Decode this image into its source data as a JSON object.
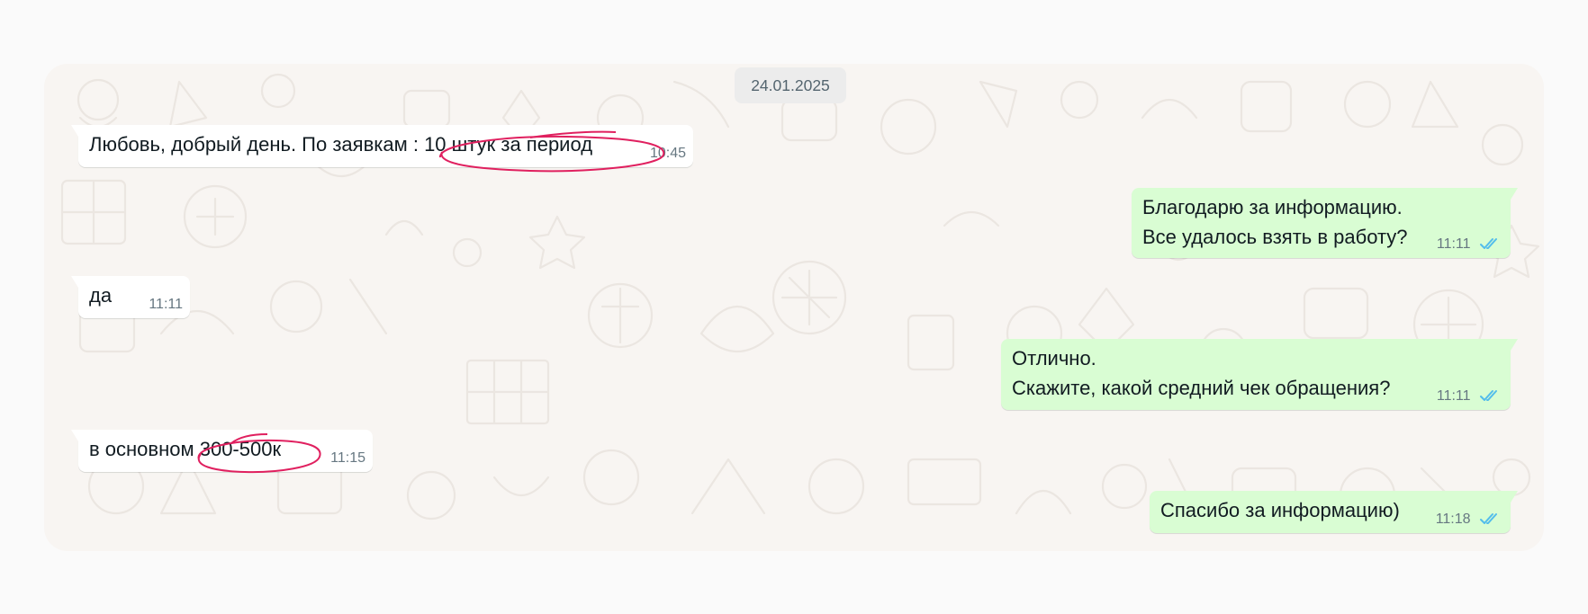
{
  "date_chip": "24.01.2025",
  "colors": {
    "incoming": "#ffffff",
    "outgoing": "#d9fdd3",
    "read_ticks": "#53bdeb",
    "highlight": "#e0205f"
  },
  "messages": [
    {
      "direction": "in",
      "lines": [
        "Любовь, добрый день. По заявкам : 10 штук за период"
      ],
      "time": "10:45"
    },
    {
      "direction": "out",
      "lines": [
        "Благодарю за информацию.",
        "Все удалось взять в работу?"
      ],
      "time": "11:11",
      "status": "read"
    },
    {
      "direction": "in",
      "lines": [
        "да"
      ],
      "time": "11:11"
    },
    {
      "direction": "out",
      "lines": [
        "Отлично.",
        "Скажите, какой средний чек обращения?"
      ],
      "time": "11:11",
      "status": "read"
    },
    {
      "direction": "in",
      "lines": [
        "в основном 300-500к"
      ],
      "time": "11:15"
    },
    {
      "direction": "out",
      "lines": [
        "Спасибо за информацию)"
      ],
      "time": "11:18",
      "status": "read"
    }
  ]
}
